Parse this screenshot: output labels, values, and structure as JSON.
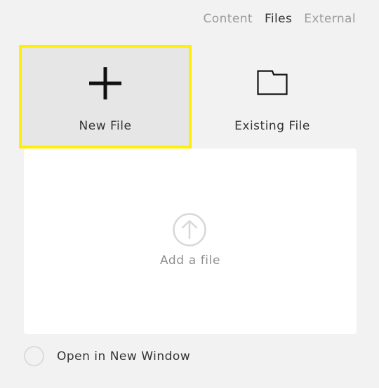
{
  "tabs": [
    {
      "label": "Content",
      "active": false
    },
    {
      "label": "Files",
      "active": true
    },
    {
      "label": "External",
      "active": false
    }
  ],
  "options": {
    "new_file": {
      "label": "New File",
      "icon": "plus-icon",
      "selected": true
    },
    "existing_file": {
      "label": "Existing File",
      "icon": "folder-icon",
      "selected": false
    }
  },
  "dropzone": {
    "label": "Add a file",
    "icon": "upload-arrow-icon"
  },
  "open_new_window": {
    "label": "Open in New Window",
    "checked": false
  },
  "colors": {
    "background": "#f2f2f2",
    "selection_border": "#ffef00",
    "selected_fill": "#e6e6e6",
    "dropzone_fill": "#ffffff",
    "active_tab": "#333333",
    "inactive_tab": "#9b9b9b"
  }
}
